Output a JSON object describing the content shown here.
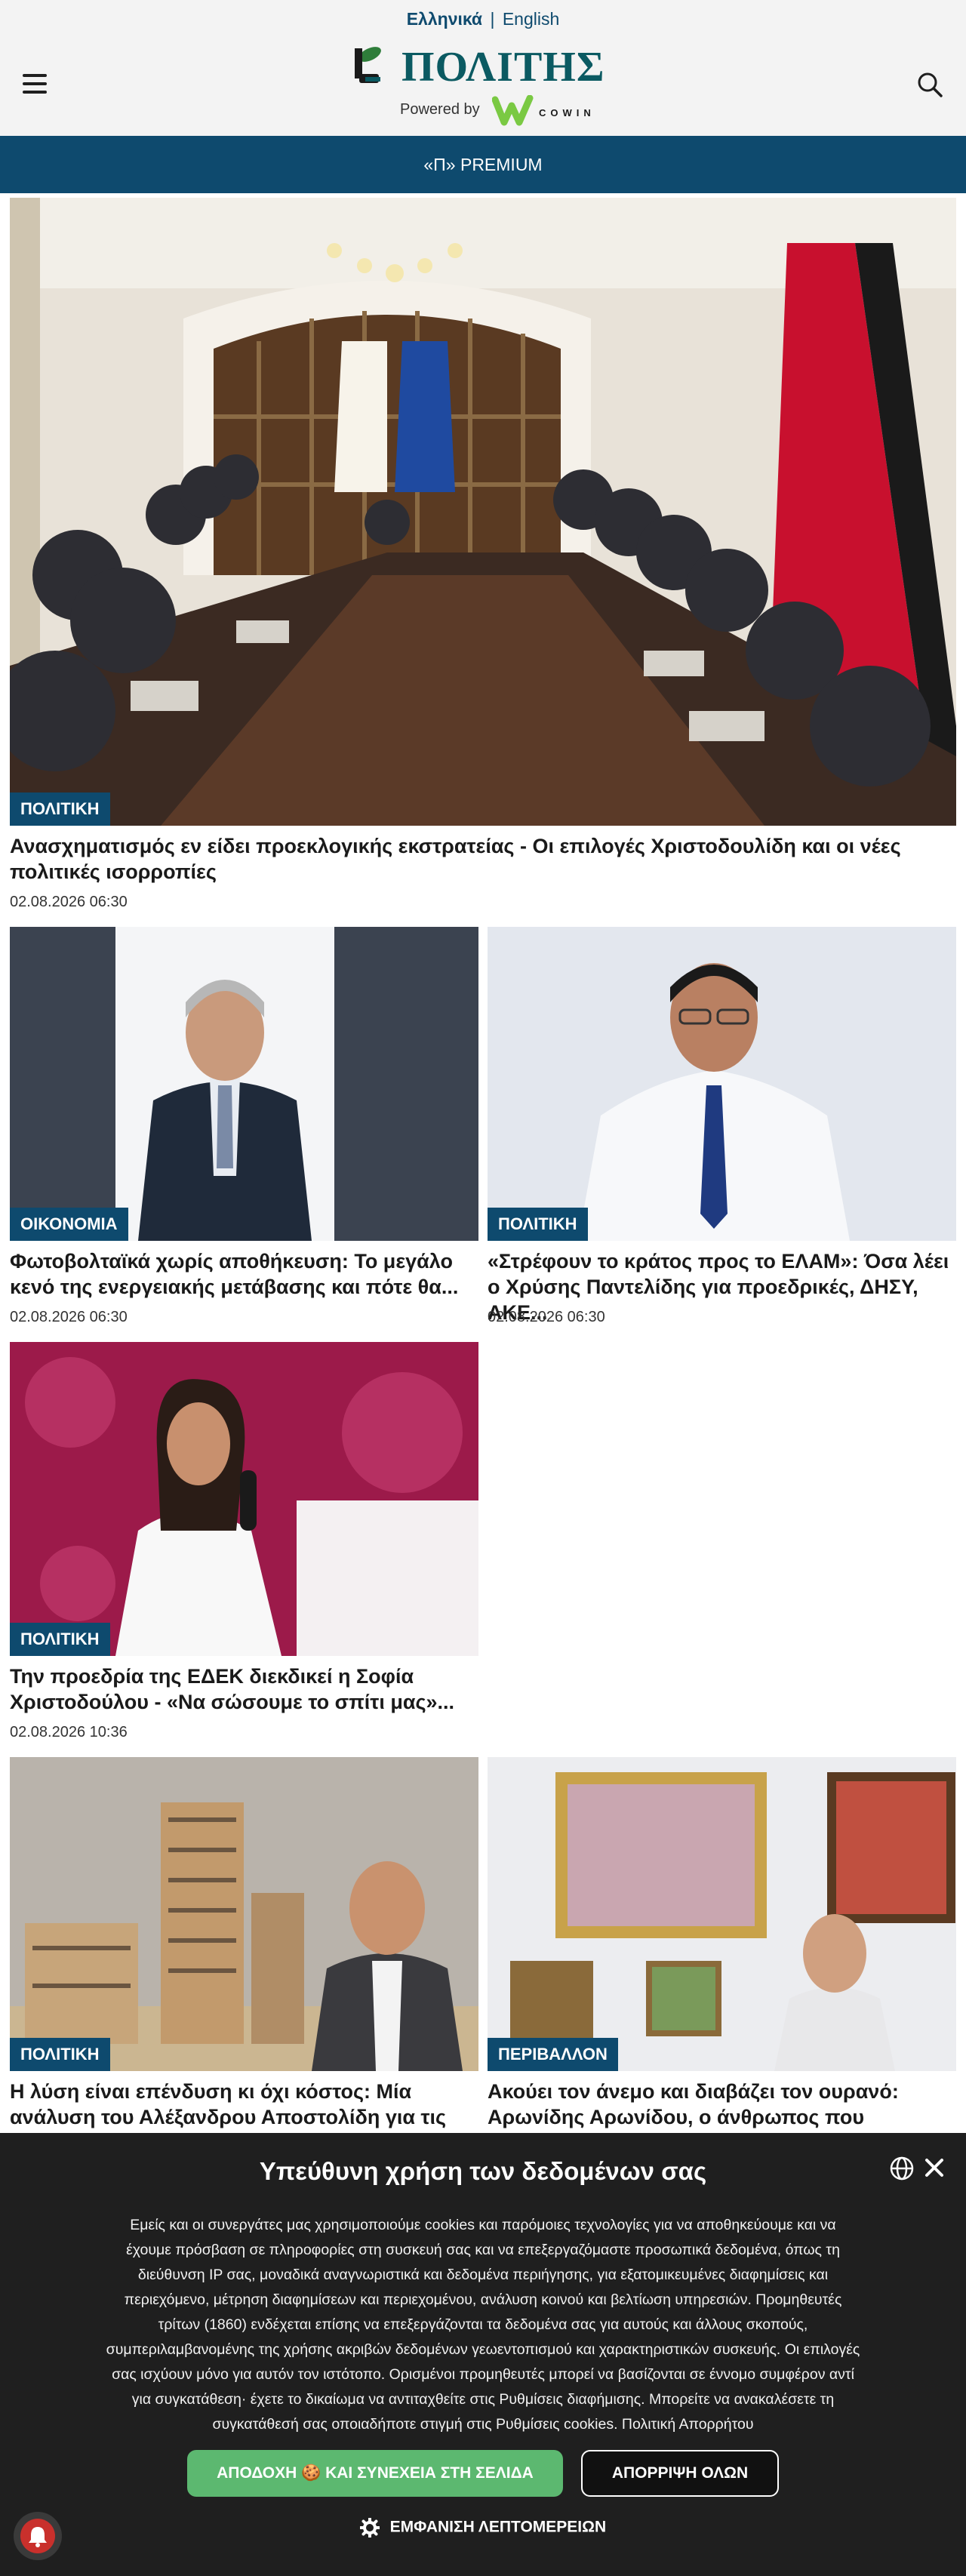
{
  "header": {
    "lang_active": "Ελληνικά",
    "lang_sep": "|",
    "lang_other": "English",
    "logo_text": "ΠΟΛΙΤΗΣ",
    "powered_by": "Powered by",
    "sponsor": "COWIN",
    "menu_icon": "hamburger-icon",
    "search_icon": "search-icon"
  },
  "premium": {
    "label": "«Π» PREMIUM"
  },
  "articles": [
    {
      "category": "ΠΟΛΙΤΙΚΗ",
      "title": "Ανασχηματισμός εν είδει προεκλογικής εκστρατείας - Οι επιλογές Χριστοδουλίδη και οι νέες πολιτικές ισορροπίες",
      "date": "02.08.2026 06:30"
    },
    {
      "category": "ΟΙΚΟΝΟΜΙΑ",
      "title": "Φωτοβολταϊκά χωρίς αποθήκευση: Το μεγάλο κενό της ενεργειακής μετάβασης και πότε θα...",
      "date": "02.08.2026 06:30"
    },
    {
      "category": "ΠΟΛΙΤΙΚΗ",
      "title": "«Στρέφουν το κράτος προς το ΕΛΑΜ»: Όσα λέει ο Χρύσης Παντελίδης για προεδρικές, ΔΗΣΥ, ΑΚΕ...",
      "date": "02.08.2026 06:30"
    },
    {
      "category": "ΠΟΛΙΤΙΚΗ",
      "title": "Την προεδρία της ΕΔΕΚ διεκδικεί η Σοφία Χριστοδούλου - «Να σώσουμε το σπίτι μας»...",
      "date": "02.08.2026 10:36"
    },
    {
      "category": "ΠΟΛΙΤΙΚΗ",
      "title": "Η λύση είναι επένδυση κι όχι κόστος: Μία ανάλυση του Αλέξανδρου Αποστολίδη για τις",
      "date": ""
    },
    {
      "category": "ΠΕΡΙΒΑΛΛΟΝ",
      "title": "Ακούει τον άνεμο και διαβάζει τον ουρανό: Αρωνίδης Αρωνίδου, ο άνθρωπος που προβλέπει",
      "date": ""
    }
  ],
  "cookie": {
    "title": "Υπεύθυνη χρήση των δεδομένων σας",
    "body": "Εμείς και οι συνεργάτες μας χρησιμοποιούμε cookies και παρόμοιες τεχνολογίες για να αποθηκεύουμε και να έχουμε πρόσβαση σε πληροφορίες στη συσκευή σας και να επεξεργαζόμαστε προσωπικά δεδομένα, όπως τη διεύθυνση IP σας, μοναδικά αναγνωριστικά και δεδομένα περιήγησης, για εξατομικευμένες διαφημίσεις και περιεχόμενο, μέτρηση διαφημίσεων και περιεχομένου, ανάλυση κοινού και βελτίωση υπηρεσιών. Προμηθευτές τρίτων (1860) ενδέχεται επίσης να επεξεργάζονται τα δεδομένα σας για αυτούς και άλλους σκοπούς, συμπεριλαμβανομένης της χρήσης ακριβών δεδομένων γεωεντοπισμού και χαρακτηριστικών συσκευής. Οι επιλογές σας ισχύουν μόνο για αυτόν τον ιστότοπο. Ορισμένοι προμηθευτές μπορεί να βασίζονται σε έννομο συμφέρον αντί για συγκατάθεση· έχετε το δικαίωμα να αντιταχθείτε στις Ρυθμίσεις διαφήμισης. Μπορείτε να ανακαλέσετε τη συγκατάθεσή σας οποιαδήποτε στιγμή στις Ρυθμίσεις cookies. Πολιτική Απορρήτου",
    "accept": "ΑΠΟΔΟΧΗ 🍪 ΚΑΙ ΣΥΝΕΧΕΙΑ ΣΤΗ ΣΕΛΙΔΑ",
    "reject": "ΑΠΟΡΡΙΨΗ ΟΛΩΝ",
    "details": "ΕΜΦΑΝΙΣΗ ΛΕΠΤΟΜΕΡΕΙΩΝ"
  },
  "colors": {
    "brand": "#0e4a6e",
    "accept": "#5cb870",
    "banner": "#1f1f1f"
  }
}
